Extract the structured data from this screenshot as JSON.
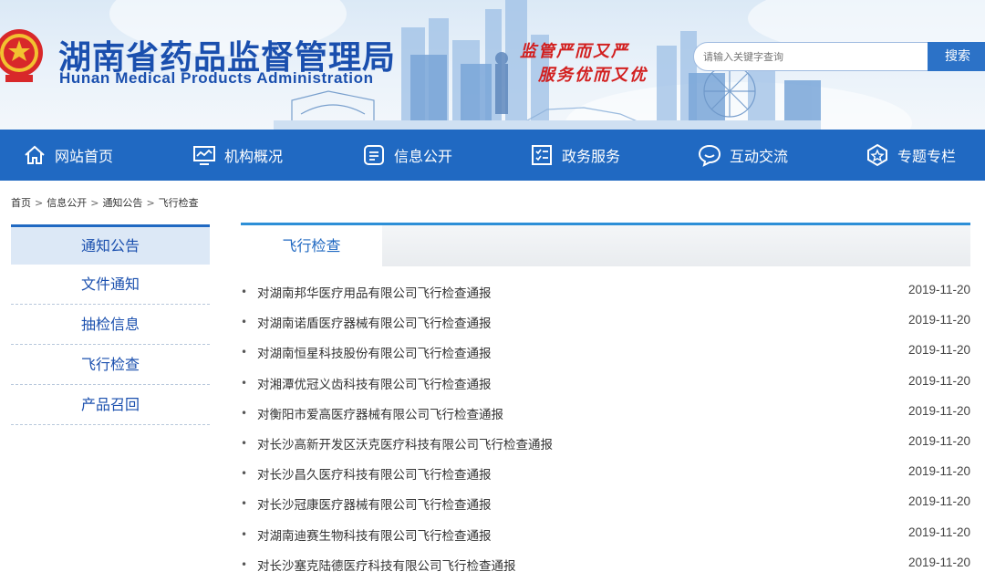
{
  "header": {
    "title": "湖南省药品监督管理局",
    "subtitle": "Hunan Medical Products Administration",
    "slogan_line1": "监管严而又严",
    "slogan_line2": "服务优而又优",
    "search_placeholder": "请输入关键字查询",
    "search_button": "搜索",
    "brand_color": "#1a4fae",
    "slogan_color": "#d21f1f",
    "emblem": "national-emblem-icon"
  },
  "nav": {
    "bg_color": "#2069c2",
    "items": [
      {
        "label": "网站首页",
        "icon": "home-icon"
      },
      {
        "label": "机构概况",
        "icon": "monitor-chart-icon"
      },
      {
        "label": "信息公开",
        "icon": "document-info-icon"
      },
      {
        "label": "政务服务",
        "icon": "checklist-icon"
      },
      {
        "label": "互动交流",
        "icon": "chat-bubble-icon"
      },
      {
        "label": "专题专栏",
        "icon": "star-badge-icon"
      }
    ]
  },
  "breadcrumb": {
    "items": [
      "首页",
      "信息公开",
      "通知公告",
      "飞行检查"
    ],
    "separator": ">"
  },
  "sidebar": {
    "items": [
      {
        "label": "通知公告",
        "active": true
      },
      {
        "label": "文件通知",
        "active": false
      },
      {
        "label": "抽检信息",
        "active": false
      },
      {
        "label": "飞行检查",
        "active": false
      },
      {
        "label": "产品召回",
        "active": false
      }
    ]
  },
  "main": {
    "tab_label": "飞行检查",
    "accent_color": "#2d8fd7",
    "list": [
      {
        "title": "对湖南邦华医疗用品有限公司飞行检查通报",
        "date": "2019-11-20"
      },
      {
        "title": "对湖南诺盾医疗器械有限公司飞行检查通报",
        "date": "2019-11-20"
      },
      {
        "title": "对湖南恒星科技股份有限公司飞行检查通报",
        "date": "2019-11-20"
      },
      {
        "title": "对湘潭优冠义齿科技有限公司飞行检查通报",
        "date": "2019-11-20"
      },
      {
        "title": "对衡阳市爱高医疗器械有限公司飞行检查通报",
        "date": "2019-11-20"
      },
      {
        "title": "对长沙高新开发区沃克医疗科技有限公司飞行检查通报",
        "date": "2019-11-20"
      },
      {
        "title": "对长沙昌久医疗科技有限公司飞行检查通报",
        "date": "2019-11-20"
      },
      {
        "title": "对长沙冠康医疗器械有限公司飞行检查通报",
        "date": "2019-11-20"
      },
      {
        "title": "对湖南迪赛生物科技有限公司飞行检查通报",
        "date": "2019-11-20"
      },
      {
        "title": "对长沙塞克陆德医疗科技有限公司飞行检查通报",
        "date": "2019-11-20"
      }
    ]
  }
}
